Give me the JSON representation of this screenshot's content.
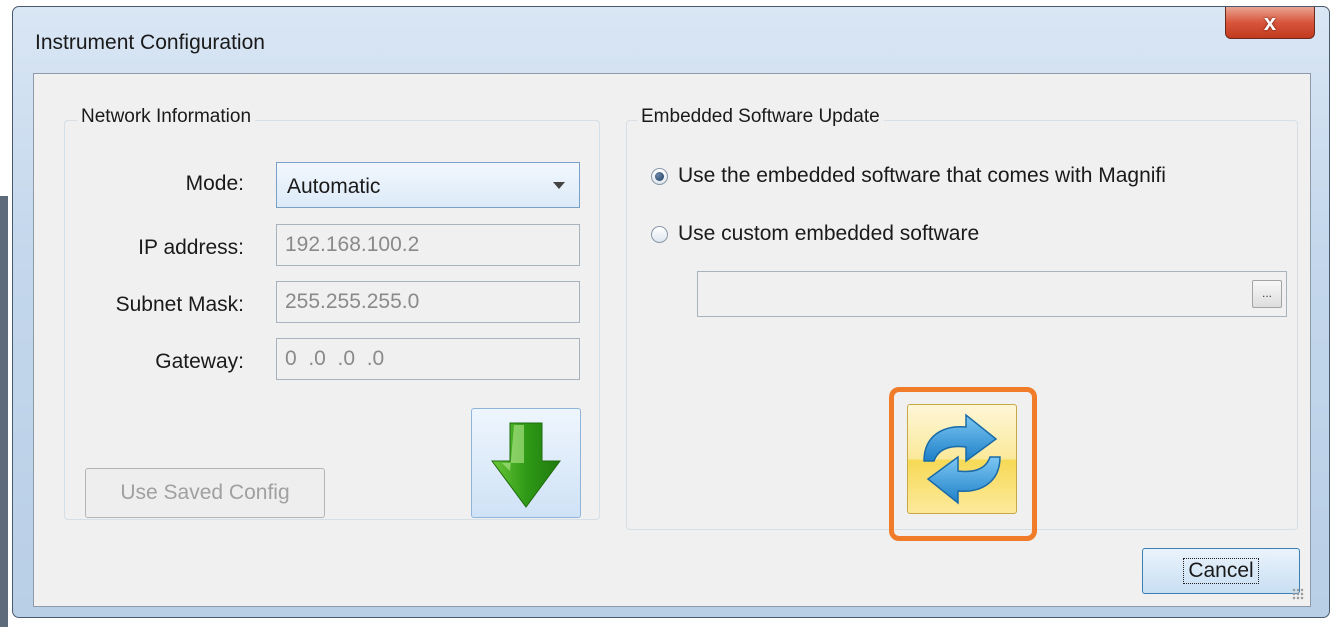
{
  "window": {
    "title": "Instrument Configuration",
    "close_label": "x"
  },
  "network": {
    "legend": "Network Information",
    "mode_label": "Mode:",
    "mode_value": "Automatic",
    "ip_label": "IP address:",
    "ip_value": "192.168.100.2",
    "subnet_label": "Subnet Mask:",
    "subnet_value": "255.255.255.0",
    "gateway_label": "Gateway:",
    "gateway_value": "0  .0  .0  .0",
    "saved_config_label": "Use Saved Config",
    "download_icon": "green-down-arrow-icon"
  },
  "update": {
    "legend": "Embedded Software Update",
    "option_default": "Use the embedded software that comes with Magnifi",
    "option_custom": "Use custom embedded software",
    "selected_option": "option_default",
    "path_value": "",
    "browse_label": "...",
    "update_icon": "refresh-arrows-icon"
  },
  "footer": {
    "cancel_label": "Cancel"
  },
  "colors": {
    "highlight": "#f07c2a",
    "close_button": "#d8553b",
    "download_arrow": "#3a9a1e",
    "update_arrows": "#3a9ad9"
  }
}
